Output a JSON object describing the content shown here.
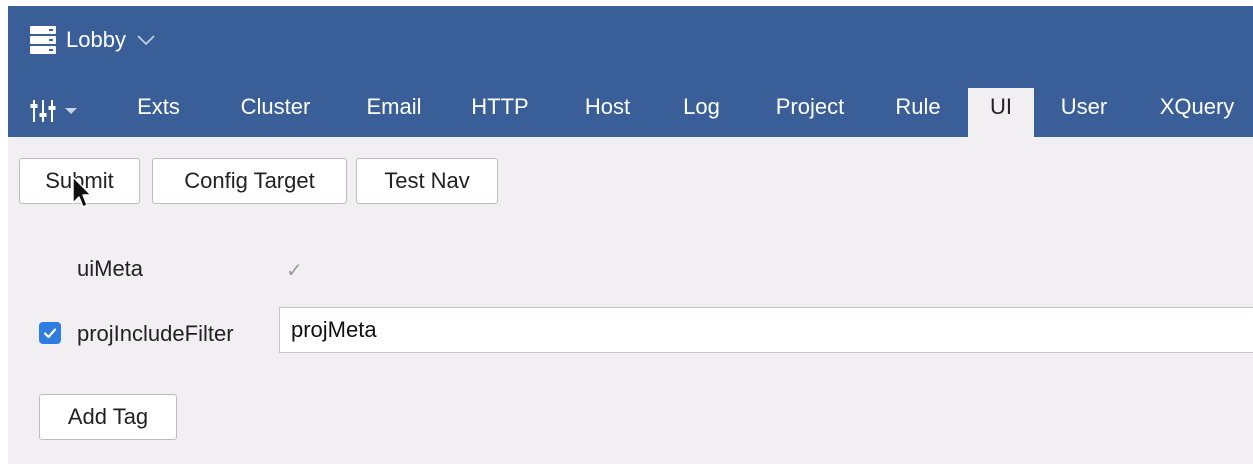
{
  "header": {
    "workspace_label": "Lobby",
    "workspace_icon": "server-icon"
  },
  "nav": {
    "tools_icon": "sliders-icon",
    "active_tab": "UI",
    "tabs": [
      {
        "label": "Exts"
      },
      {
        "label": "Cluster"
      },
      {
        "label": "Email"
      },
      {
        "label": "HTTP"
      },
      {
        "label": "Host"
      },
      {
        "label": "Log"
      },
      {
        "label": "Project"
      },
      {
        "label": "Rule"
      },
      {
        "label": "UI"
      },
      {
        "label": "User"
      },
      {
        "label": "XQuery"
      }
    ]
  },
  "toolbar": {
    "submit_label": "Submit",
    "config_target_label": "Config Target",
    "test_nav_label": "Test Nav"
  },
  "form": {
    "ui_meta_label": "uiMeta",
    "ui_meta_value": "✓",
    "proj_include_filter_label": "projIncludeFilter",
    "proj_include_filter_checked": true,
    "proj_include_filter_value": "projMeta",
    "add_tag_label": "Add Tag"
  },
  "colors": {
    "header_bg": "#3a5f98",
    "content_bg": "#f1eff2",
    "checkbox_accent": "#2f7de0"
  }
}
